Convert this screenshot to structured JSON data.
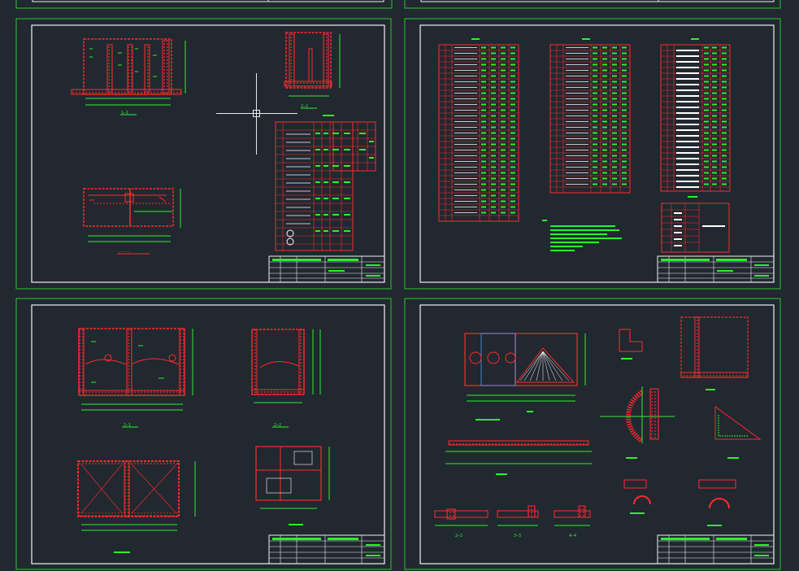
{
  "colors": {
    "background": "#212830",
    "sheet_border": "#28c828",
    "frame": "#f0f0f0",
    "geometry": "#ff2a2a",
    "annotation": "#2cf02c",
    "crosshair": "#e8e8e8"
  },
  "cursor": {
    "icon": "crosshair-cursor-icon"
  },
  "sheets": [
    {
      "id": "sheet-1",
      "section_labels": [
        "1—1",
        "2—2",
        "1—1"
      ]
    },
    {
      "id": "sheet-2",
      "section_labels": []
    },
    {
      "id": "sheet-3",
      "section_labels": [
        "1—1",
        "2—2"
      ]
    },
    {
      "id": "sheet-4",
      "section_labels": [
        "1—1",
        "2—2",
        "3—3",
        "4—4"
      ]
    }
  ]
}
